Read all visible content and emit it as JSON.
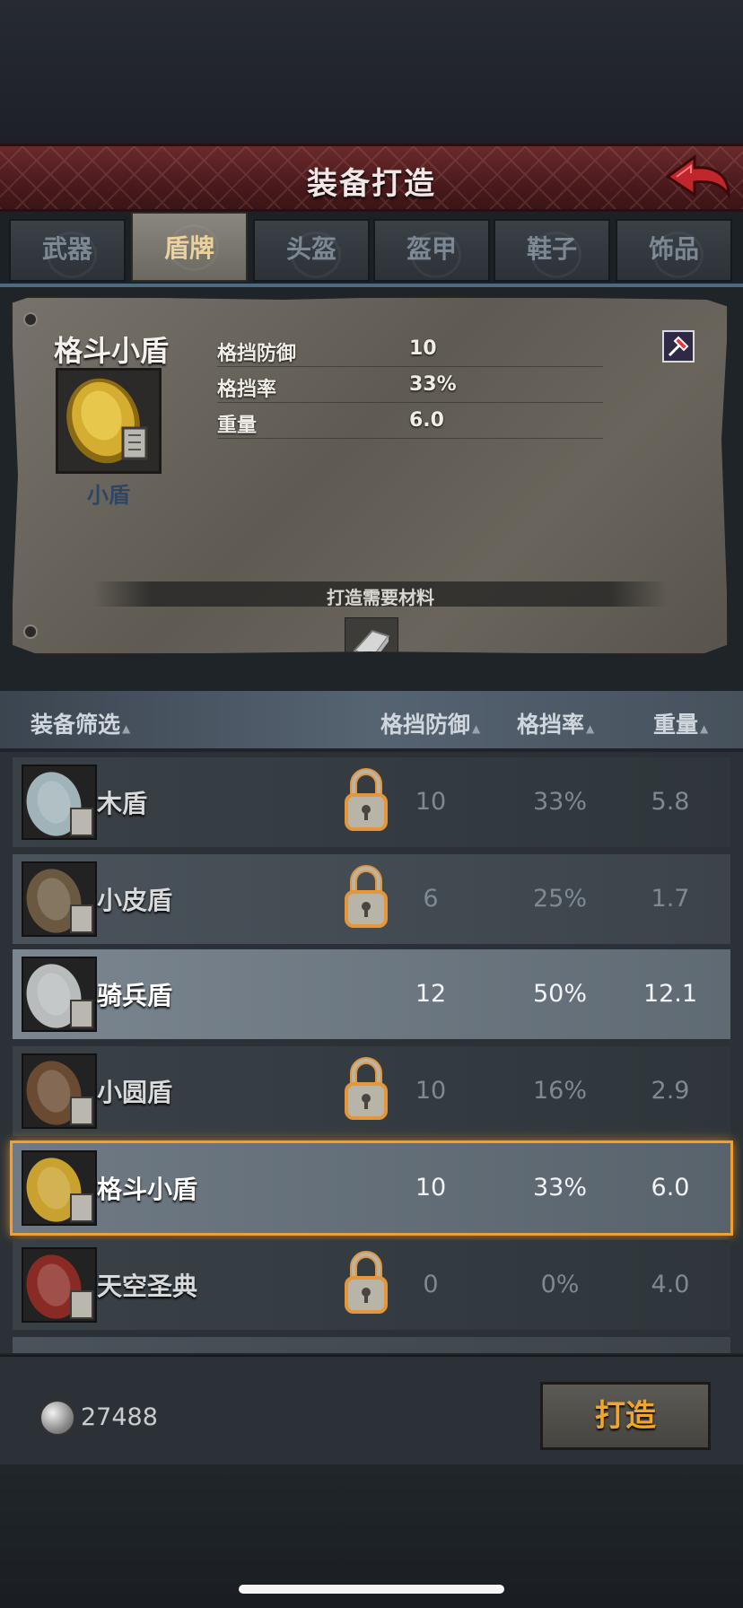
{
  "header": {
    "title": "装备打造"
  },
  "tabs": [
    {
      "label": "武器",
      "active": false
    },
    {
      "label": "盾牌",
      "active": true
    },
    {
      "label": "头盔",
      "active": false
    },
    {
      "label": "盔甲",
      "active": false
    },
    {
      "label": "鞋子",
      "active": false
    },
    {
      "label": "饰品",
      "active": false
    }
  ],
  "detail": {
    "name": "格斗小盾",
    "type": "小盾",
    "stats": [
      {
        "label": "格挡防御",
        "value": "10"
      },
      {
        "label": "格挡率",
        "value": "33%"
      },
      {
        "label": "重量",
        "value": "6.0"
      }
    ],
    "materials_label": "打造需要材料",
    "material_count": "1"
  },
  "filter": {
    "label": "装备筛选",
    "col1": "格挡防御",
    "col2": "格挡率",
    "col3": "重量"
  },
  "items": [
    {
      "name": "木盾",
      "block_def": "10",
      "block_rate": "33%",
      "weight": "5.8",
      "locked": true,
      "style": "dark",
      "icon": "wood-shield-icon",
      "color": "#9fb3b8"
    },
    {
      "name": "小皮盾",
      "block_def": "6",
      "block_rate": "25%",
      "weight": "1.7",
      "locked": true,
      "style": "alt",
      "icon": "leather-shield-icon",
      "color": "#6b5840"
    },
    {
      "name": "骑兵盾",
      "block_def": "12",
      "block_rate": "50%",
      "weight": "12.1",
      "locked": false,
      "style": "bright",
      "icon": "cavalry-shield-icon",
      "color": "#b9bcbd"
    },
    {
      "name": "小圆盾",
      "block_def": "10",
      "block_rate": "16%",
      "weight": "2.9",
      "locked": true,
      "style": "dark",
      "icon": "round-shield-icon",
      "color": "#6a4a30"
    },
    {
      "name": "格斗小盾",
      "block_def": "10",
      "block_rate": "33%",
      "weight": "6.0",
      "locked": false,
      "style": "selected",
      "icon": "buckler-icon",
      "color": "#c9a12e"
    },
    {
      "name": "天空圣典",
      "block_def": "0",
      "block_rate": "0%",
      "weight": "4.0",
      "locked": true,
      "style": "dark",
      "icon": "sky-tome-icon",
      "color": "#8a2a24"
    }
  ],
  "currency": {
    "amount": "27488",
    "icon": "silver-coin-icon"
  },
  "forge_button": {
    "label": "打造"
  },
  "colors": {
    "accent": "#f1a629",
    "title_bar": "#5a2023",
    "selection": "#f0a030",
    "lock": "#e5963a"
  }
}
